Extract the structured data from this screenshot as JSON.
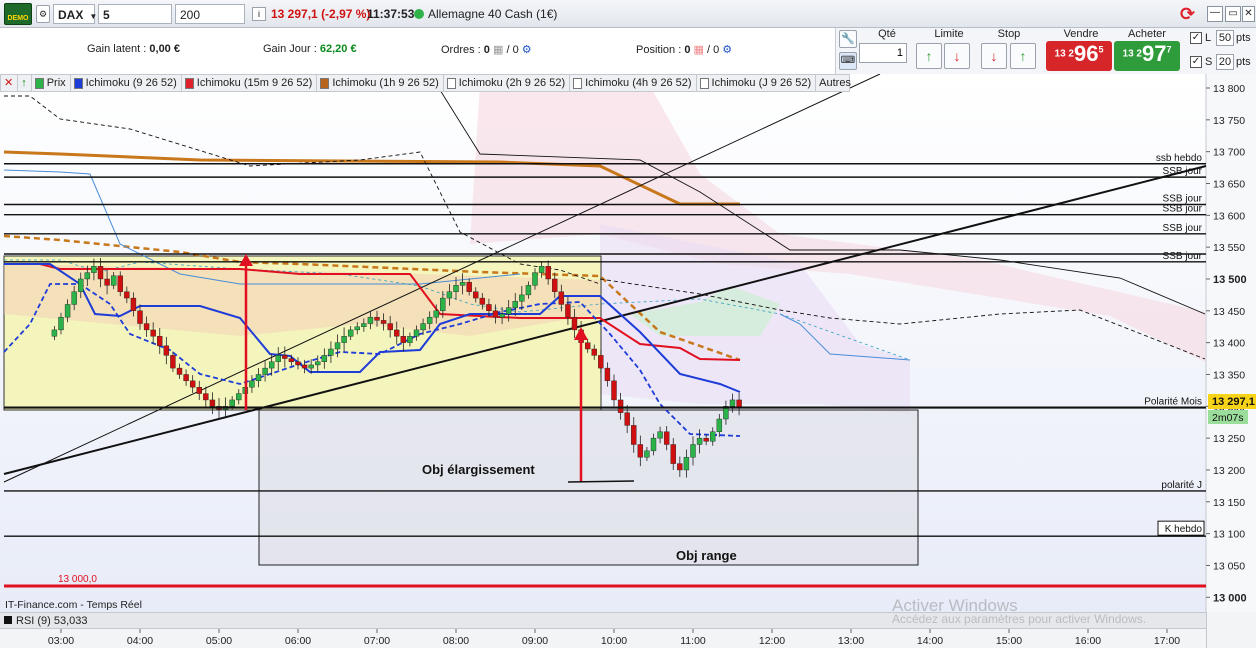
{
  "toolbar": {
    "logo": "DEMO",
    "instrument": "DAX",
    "timeframe": "5 minutes",
    "units": "200 unités",
    "last_price": "13 297,1",
    "change": "(-2,97 %)",
    "time": "11:37:53",
    "market_name": "Allemagne 40 Cash (1€)",
    "colors": {
      "down": "#d01010",
      "up": "#0a7a1e"
    }
  },
  "info": {
    "gain_latent_label": "Gain latent :",
    "gain_latent_value": "0,00 €",
    "gain_jour_label": "Gain Jour :",
    "gain_jour_value": "62,20 €",
    "ordres_label": "Ordres :",
    "ordres_value": "0",
    "ordres_sub": "/ 0",
    "position_label": "Position :",
    "position_value": "0",
    "position_sub": "/ 0"
  },
  "order_panel": {
    "qte_label": "Qté",
    "qte_value": "1",
    "limite_label": "Limite",
    "stop_label": "Stop",
    "vendre_label": "Vendre",
    "vendre_prefix": "13 2",
    "vendre_big": "96",
    "vendre_sup": "5",
    "acheter_label": "Acheter",
    "acheter_prefix": "13 2",
    "acheter_big": "97",
    "acheter_sup": "7",
    "l_label": "L",
    "l_value": "50",
    "s_label": "S",
    "s_value": "20",
    "pts": "pts",
    "colors": {
      "sell": "#d7262a",
      "buy": "#2e9c3a"
    }
  },
  "indicator_bar": {
    "items": [
      {
        "label": "Prix",
        "color": "#2bb34a"
      },
      {
        "label": "Ichimoku (9 26 52)",
        "color": "#1e3cd8"
      },
      {
        "label": "Ichimoku (15m 9 26 52)",
        "color": "#e0202a"
      },
      {
        "label": "Ichimoku (1h 9 26 52)",
        "color": "#b8641c"
      },
      {
        "label": "Ichimoku (2h 9 26 52)",
        "color": "#ffffff"
      },
      {
        "label": "Ichimoku (4h 9 26 52)",
        "color": "#ffffff"
      },
      {
        "label": "Ichimoku (J 9 26 52)",
        "color": "#ffffff"
      }
    ],
    "autres": "Autres"
  },
  "price_axis": {
    "ticks": [
      "13 800",
      "13 750",
      "13 700",
      "13 650",
      "13 600",
      "13 550",
      "13 500",
      "13 450",
      "13 400",
      "13 350",
      "13 300",
      "13 250",
      "13 200",
      "13 150",
      "13 100",
      "13 050",
      "13 000"
    ],
    "current_price": "13 297,1",
    "countdown": "2m07s"
  },
  "levels": [
    {
      "label": "ssb hebdo",
      "price": 13681
    },
    {
      "label": "SSB jour",
      "price": 13660
    },
    {
      "label": "SSB jour",
      "price": 13617
    },
    {
      "label": "SSB jour",
      "price": 13601
    },
    {
      "label": "SSB jour",
      "price": 13571
    },
    {
      "label": "SSB jour",
      "price": 13527
    },
    {
      "label": "Polarité Mois",
      "price": 13298
    },
    {
      "label": "polarité J",
      "price": 13167
    },
    {
      "label": "K hebdo",
      "price": 13096
    }
  ],
  "annotations": {
    "obj_elargissement": "Obj élargissement",
    "obj_range": "Obj range",
    "level_13000": "13 000,0"
  },
  "footer": {
    "source": "IT-Finance.com - Temps Réel",
    "rsi": "RSI (9) 53,033",
    "time_ticks": [
      "03:00",
      "04:00",
      "05:00",
      "06:00",
      "07:00",
      "08:00",
      "09:00",
      "10:00",
      "11:00",
      "12:00",
      "13:00",
      "14:00",
      "15:00",
      "16:00",
      "17:00"
    ],
    "watermark_title": "Activer Windows",
    "watermark_sub": "Accédez aux paramètres pour activer Windows."
  },
  "chart_data": {
    "type": "candlestick",
    "instrument": "DAX",
    "ylim": [
      12995,
      13820
    ],
    "x": [
      "02:55",
      "03:00",
      "03:05",
      "03:10",
      "03:15",
      "03:20",
      "03:25",
      "03:30",
      "03:35",
      "03:40",
      "03:45",
      "03:50",
      "03:55",
      "04:00",
      "04:05",
      "04:10",
      "04:15",
      "04:20",
      "04:25",
      "04:30",
      "04:35",
      "04:40",
      "04:45",
      "04:50",
      "04:55",
      "05:00",
      "05:05",
      "05:10",
      "05:15",
      "05:20",
      "05:25",
      "05:30",
      "05:35",
      "05:40",
      "05:45",
      "05:50",
      "05:55",
      "06:00",
      "06:05",
      "06:10",
      "06:15",
      "06:20",
      "06:25",
      "06:30",
      "06:35",
      "06:40",
      "06:45",
      "06:50",
      "06:55",
      "07:00",
      "07:05",
      "07:10",
      "07:15",
      "07:20",
      "07:25",
      "07:30",
      "07:35",
      "07:40",
      "07:45",
      "07:50",
      "07:55",
      "08:00",
      "08:05",
      "08:10",
      "08:15",
      "08:20",
      "08:25",
      "08:30",
      "08:35",
      "08:40",
      "08:45",
      "08:50",
      "08:55",
      "09:00",
      "09:05",
      "09:10",
      "09:15",
      "09:20",
      "09:25",
      "09:30",
      "09:35",
      "09:40",
      "09:45",
      "09:50",
      "09:55",
      "10:00",
      "10:05",
      "10:10",
      "10:15",
      "10:20",
      "10:25",
      "10:30",
      "10:35",
      "10:40",
      "10:45",
      "10:50",
      "10:55",
      "11:00",
      "11:05",
      "11:10",
      "11:15",
      "11:20",
      "11:25",
      "11:30",
      "11:35"
    ],
    "close": [
      13420,
      13440,
      13460,
      13480,
      13500,
      13510,
      13520,
      13500,
      13490,
      13505,
      13480,
      13470,
      13450,
      13430,
      13420,
      13410,
      13395,
      13380,
      13360,
      13350,
      13340,
      13330,
      13320,
      13310,
      13300,
      13295,
      13300,
      13310,
      13320,
      13330,
      13340,
      13350,
      13360,
      13370,
      13380,
      13375,
      13370,
      13365,
      13360,
      13365,
      13370,
      13380,
      13390,
      13400,
      13410,
      13420,
      13425,
      13430,
      13440,
      13435,
      13430,
      13420,
      13410,
      13400,
      13410,
      13420,
      13430,
      13440,
      13450,
      13470,
      13480,
      13490,
      13495,
      13480,
      13470,
      13460,
      13450,
      13440,
      13445,
      13455,
      13465,
      13475,
      13490,
      13510,
      13520,
      13500,
      13480,
      13460,
      13440,
      13420,
      13400,
      13390,
      13380,
      13360,
      13340,
      13310,
      13290,
      13270,
      13240,
      13220,
      13230,
      13250,
      13260,
      13240,
      13210,
      13200,
      13220,
      13240,
      13250,
      13245,
      13260,
      13280,
      13300,
      13310,
      13297
    ],
    "series": [
      {
        "name": "Ichimoku (9 26 52)",
        "color": "#1e3cd8"
      },
      {
        "name": "Ichimoku (15m 9 26 52)",
        "color": "#e0202a"
      },
      {
        "name": "Ichimoku (1h 9 26 52)",
        "color": "#b8641c"
      }
    ]
  }
}
